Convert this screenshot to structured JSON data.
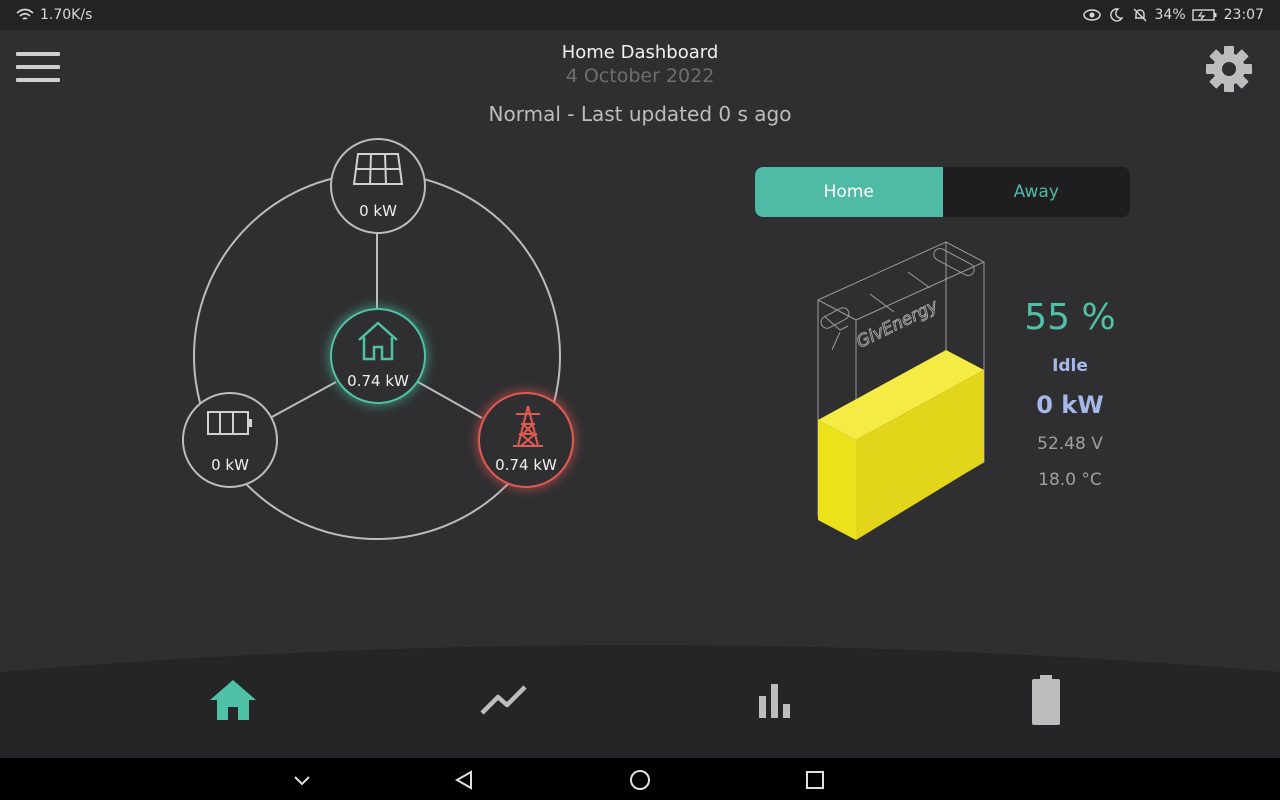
{
  "statusbar": {
    "speed": "1.70K/s",
    "battery_pct": "34%",
    "time": "23:07"
  },
  "header": {
    "title": "Home Dashboard",
    "date": "4 October 2022",
    "status": "Normal - Last updated 0 s ago"
  },
  "flow": {
    "solar": {
      "value": "0 kW",
      "icon": "solar-panel-icon"
    },
    "home": {
      "value": "0.74 kW",
      "icon": "house-icon"
    },
    "battery": {
      "value": "0 kW",
      "icon": "battery-icon"
    },
    "grid": {
      "value": "0.74 kW",
      "icon": "pylon-icon"
    }
  },
  "toggle": {
    "home_label": "Home",
    "away_label": "Away",
    "selected": "Home"
  },
  "battery": {
    "brand": "GivEnergy",
    "percent": "55 %",
    "percent_value": 55,
    "state": "Idle",
    "power": "0 kW",
    "voltage": "52.48 V",
    "temperature": "18.0 °C"
  },
  "nav": {
    "items": [
      {
        "name": "home",
        "icon": "home-icon",
        "active": true
      },
      {
        "name": "trends",
        "icon": "line-chart-icon",
        "active": false
      },
      {
        "name": "stats",
        "icon": "bar-chart-icon",
        "active": false
      },
      {
        "name": "battery",
        "icon": "battery-nav-icon",
        "active": false
      }
    ]
  },
  "colors": {
    "accent": "#4fc1a6",
    "grid": "#e05a52",
    "battery_fill": "#f0e81e",
    "info": "#a6b8e8"
  }
}
